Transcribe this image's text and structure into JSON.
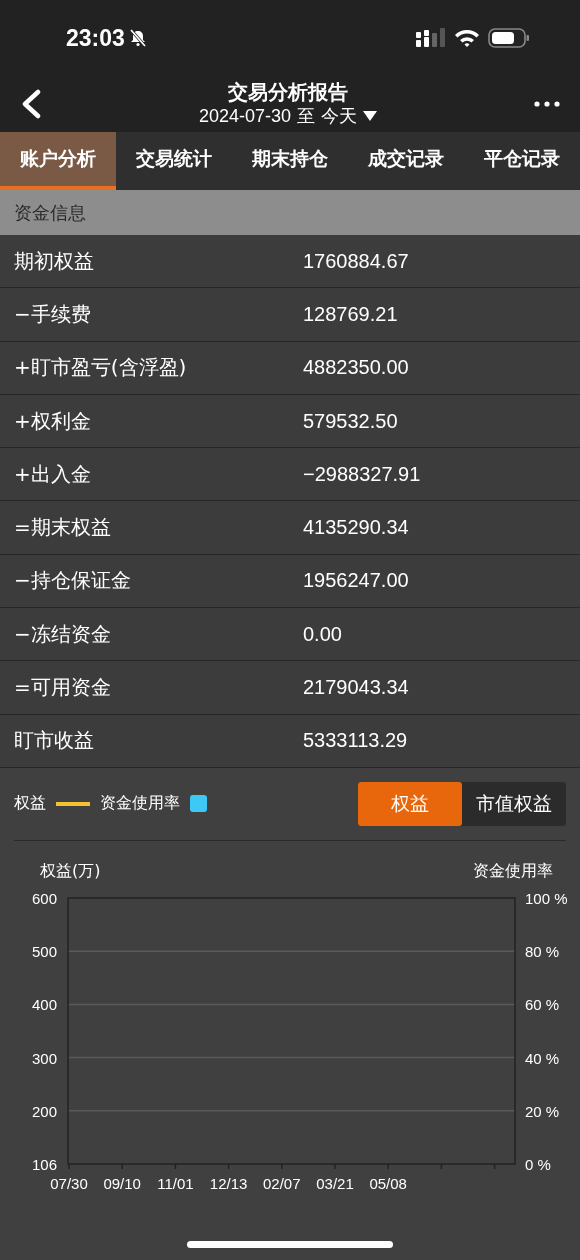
{
  "status_bar": {
    "time": "23:03"
  },
  "nav": {
    "title": "交易分析报告",
    "date_from": "2024-07-30",
    "separator": "至",
    "date_to": "今天"
  },
  "tabs": [
    {
      "label": "账户分析",
      "selected": true
    },
    {
      "label": "交易统计",
      "selected": false
    },
    {
      "label": "期末持仓",
      "selected": false
    },
    {
      "label": "成交记录",
      "selected": false
    },
    {
      "label": "平仓记录",
      "selected": false
    }
  ],
  "section": {
    "title": "资金信息"
  },
  "rows": [
    {
      "label": "期初权益",
      "value": "1760884.67"
    },
    {
      "label": "−手续费",
      "value": "128769.21"
    },
    {
      "label": "+盯市盈亏(含浮盈)",
      "value": "4882350.00"
    },
    {
      "label": "+权利金",
      "value": "579532.50"
    },
    {
      "label": "+出入金",
      "value": "−2988327.91"
    },
    {
      "label": "=期末权益",
      "value": "4135290.34"
    },
    {
      "label": "−持仓保证金",
      "value": "1956247.00"
    },
    {
      "label": "−冻结资金",
      "value": "0.00"
    },
    {
      "label": "=可用资金",
      "value": "2179043.34"
    },
    {
      "label": "盯市收益",
      "value": "5333113.29"
    }
  ],
  "legend": [
    {
      "label": "权益",
      "kind": "line",
      "color": "#f2c230"
    },
    {
      "label": "资金使用率",
      "kind": "square",
      "color": "#3ec8f5"
    }
  ],
  "toggle": [
    {
      "label": "权益",
      "selected": true
    },
    {
      "label": "市值权益",
      "selected": false
    }
  ],
  "chart": {
    "y_left_title": "权益(万)",
    "y_right_title": "资金使用率",
    "y_left_ticks": [
      "600",
      "500",
      "400",
      "300",
      "200",
      "106"
    ],
    "y_right_ticks": [
      "100 %",
      "80 %",
      "60 %",
      "40 %",
      "20 %",
      "0 %"
    ],
    "x_labels": [
      "07/30",
      "09/10",
      "11/01",
      "12/13",
      "02/07",
      "03/21",
      "05/08"
    ]
  }
}
